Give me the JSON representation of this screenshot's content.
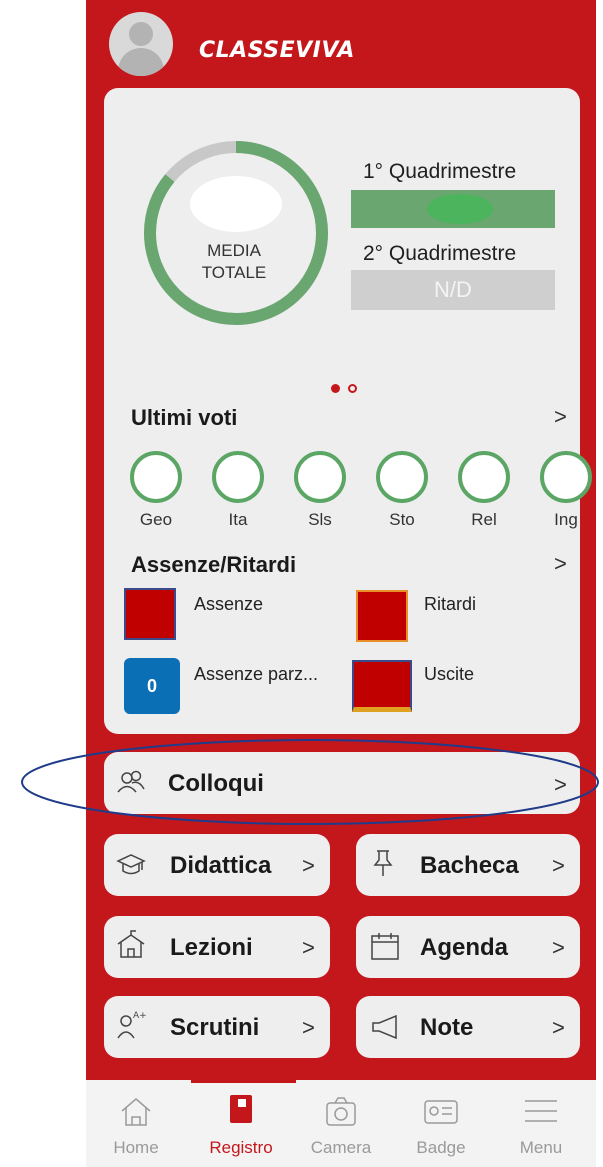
{
  "header": {
    "brand": "CLASSEVIVA"
  },
  "summary": {
    "media_label_line1": "MEDIA",
    "media_label_line2": "TOTALE",
    "q1_label": "1° Quadrimestre",
    "q2_label": "2° Quadrimestre",
    "q2_value": "N/D",
    "ring_green_fraction": 0.86,
    "accent_green": "#6aa770",
    "accent_gray": "#c8c8c8"
  },
  "ultimi_voti": {
    "title": "Ultimi voti",
    "subjects": [
      "Geo",
      "Ita",
      "Sls",
      "Sto",
      "Rel",
      "Ing"
    ]
  },
  "assenze": {
    "title": "Assenze/Ritardi",
    "items": [
      {
        "label": "Assenze"
      },
      {
        "label": "Ritardi"
      },
      {
        "label": "Assenze parz...",
        "value": "0"
      },
      {
        "label": "Uscite"
      }
    ]
  },
  "buttons": {
    "colloqui": "Colloqui",
    "didattica": "Didattica",
    "bacheca": "Bacheca",
    "lezioni": "Lezioni",
    "agenda": "Agenda",
    "scrutini": "Scrutini",
    "note": "Note",
    "chevron": ">"
  },
  "nav": {
    "items": [
      {
        "label": "Home",
        "icon": "home-icon"
      },
      {
        "label": "Registro",
        "icon": "book-icon",
        "active": true
      },
      {
        "label": "Camera",
        "icon": "camera-icon"
      },
      {
        "label": "Badge",
        "icon": "badge-icon"
      },
      {
        "label": "Menu",
        "icon": "menu-icon"
      }
    ],
    "active_color": "#c4171c",
    "inactive_color": "#9a9a9a"
  }
}
